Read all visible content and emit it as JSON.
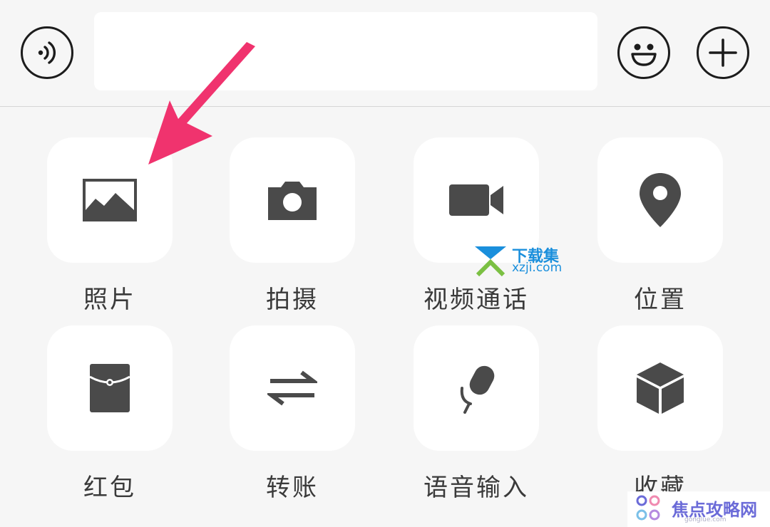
{
  "input_bar": {
    "voice_icon": "voice-icon",
    "emoji_icon": "smiley-icon",
    "plus_icon": "plus-icon",
    "text_value": ""
  },
  "actions": [
    {
      "label": "照片",
      "icon": "photo-icon"
    },
    {
      "label": "拍摄",
      "icon": "camera-icon"
    },
    {
      "label": "视频通话",
      "icon": "video-call-icon"
    },
    {
      "label": "位置",
      "icon": "location-pin-icon"
    },
    {
      "label": "红包",
      "icon": "red-packet-icon"
    },
    {
      "label": "转账",
      "icon": "transfer-icon"
    },
    {
      "label": "语音输入",
      "icon": "microphone-icon"
    },
    {
      "label": "收藏",
      "icon": "favorites-cube-icon"
    }
  ],
  "annotation": {
    "color": "#f0336e"
  },
  "watermarks": {
    "xzji": {
      "title": "下载集",
      "sub": "xzji.com",
      "color": "#1a8fdc"
    },
    "jiaodian": {
      "title": "焦点攻略网",
      "sub": "gonglue.com",
      "color": "#6b6bd8"
    }
  },
  "colors": {
    "icon": "#4a4a4a",
    "background": "#f6f6f6",
    "tile": "#ffffff"
  }
}
